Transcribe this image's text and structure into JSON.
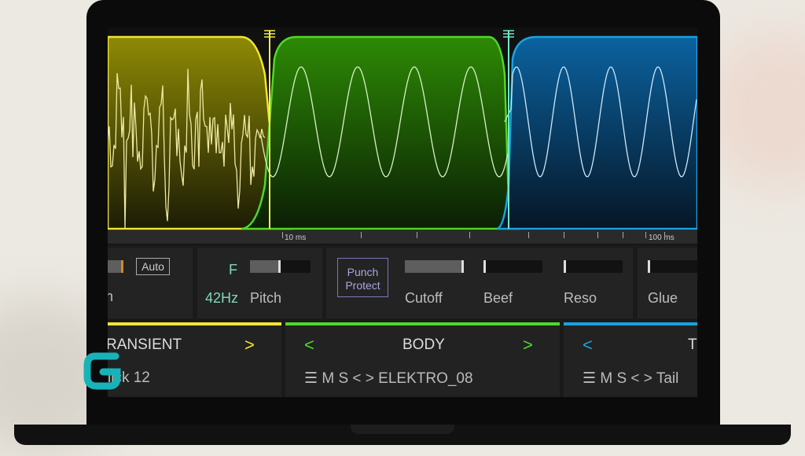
{
  "ruler": {
    "labels": [
      "10 ms",
      "100 ms"
    ]
  },
  "controls": {
    "auto_label": "Auto",
    "partial_label": "n",
    "pitch_key": "F",
    "pitch_hz": "42Hz",
    "pitch_label": "Pitch",
    "pitch_value": 0.5,
    "punch_label_1": "Punch",
    "punch_label_2": "Protect",
    "cutoff_label": "Cutoff",
    "cutoff_value": 1.0,
    "beef_label": "Beef",
    "beef_value": 0.0,
    "reso_label": "Reso",
    "reso_value": 0.0,
    "glue_label": "Glue",
    "glue_value": 0.0
  },
  "sections": [
    {
      "title": "RANSIENT",
      "next": ">",
      "sample": "lick 12",
      "color": "#f2e531"
    },
    {
      "title": "BODY",
      "prev": "<",
      "next": ">",
      "menu": "☰",
      "m": "M",
      "s": "S",
      "nav": "< >",
      "sample": "ELEKTRO_08",
      "color": "#4fd82a"
    },
    {
      "title": "T",
      "prev": "<",
      "menu": "☰",
      "m": "M",
      "s": "S",
      "nav": "< >",
      "sample": "Tail",
      "color": "#1aa3e0"
    }
  ],
  "colors": {
    "transient": "#f2e531",
    "body": "#4fd82a",
    "tail": "#1aa3e0",
    "logo": "#17b3b8"
  }
}
